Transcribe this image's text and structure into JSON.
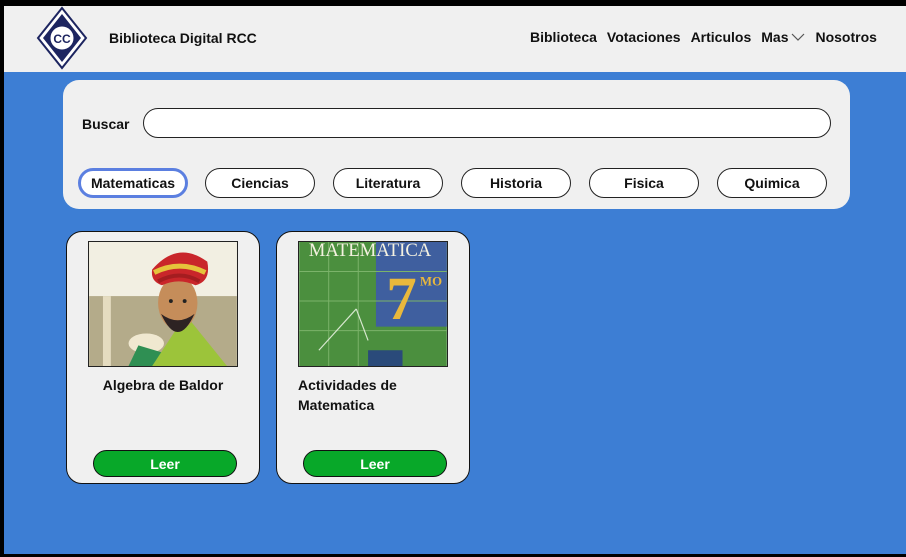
{
  "header": {
    "logo_text": "CC",
    "brand": "Biblioteca Digital RCC",
    "nav": [
      {
        "label": "Biblioteca"
      },
      {
        "label": "Votaciones"
      },
      {
        "label": "Articulos"
      },
      {
        "label": "Mas"
      },
      {
        "label": "Nosotros"
      }
    ]
  },
  "search": {
    "label": "Buscar",
    "value": "",
    "placeholder": ""
  },
  "categories": [
    {
      "label": "Matematicas",
      "active": true
    },
    {
      "label": "Ciencias",
      "active": false
    },
    {
      "label": "Literatura",
      "active": false
    },
    {
      "label": "Historia",
      "active": false
    },
    {
      "label": "Fisica",
      "active": false
    },
    {
      "label": "Quimica",
      "active": false
    }
  ],
  "books": [
    {
      "title": "Algebra de Baldor",
      "button": "Leer"
    },
    {
      "title": "Actividades de Matematica",
      "button": "Leer",
      "cover_text": "MATEMATICA",
      "cover_number": "7",
      "cover_suffix": "MO"
    }
  ],
  "colors": {
    "background": "#3d7ed4",
    "panel": "#f0f0f0",
    "button_green": "#08a829",
    "active_chip_border": "#5b7fe0"
  }
}
